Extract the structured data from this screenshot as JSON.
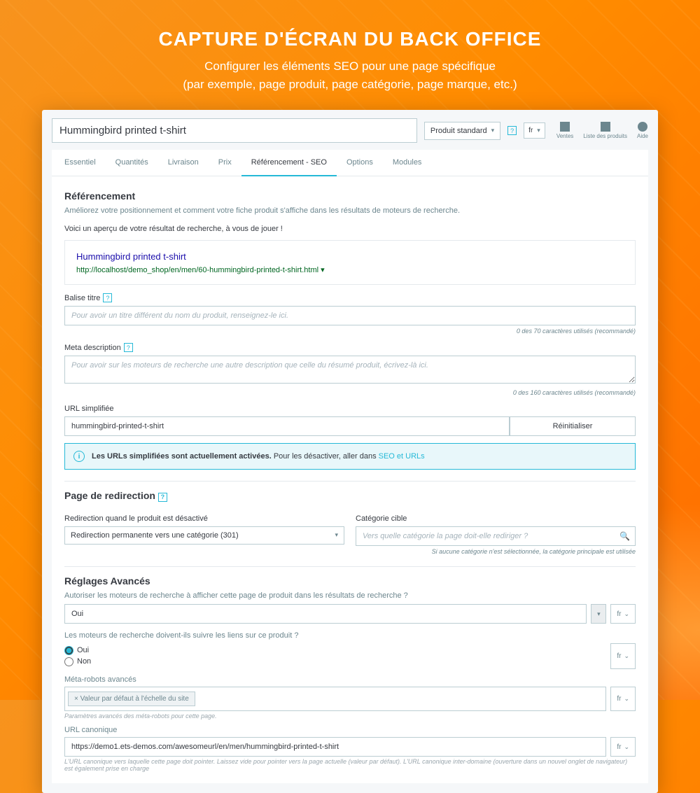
{
  "hero": {
    "title": "CAPTURE D'ÉCRAN DU BACK OFFICE",
    "line1": "Configurer les éléments SEO pour une page spécifique",
    "line2": "(par exemple, page produit, page catégorie, page marque, etc.)"
  },
  "topbar": {
    "title": "Hummingbird printed t-shirt",
    "productType": "Produit standard",
    "lang": "fr",
    "icons": {
      "sales": "Ventes",
      "list": "Liste des produits",
      "help": "Aide"
    }
  },
  "tabs": [
    "Essentiel",
    "Quantités",
    "Livraison",
    "Prix",
    "Référencement - SEO",
    "Options",
    "Modules"
  ],
  "tabs_active": 4,
  "seo": {
    "heading": "Référencement",
    "intro": "Améliorez votre positionnement et comment votre fiche produit s'affiche dans les résultats de moteurs de recherche.",
    "previewLabel": "Voici un aperçu de votre résultat de recherche, à vous de jouer !",
    "preview": {
      "title": "Hummingbird printed t-shirt",
      "url": "http://localhost/demo_shop/en/men/60-hummingbird-printed-t-shirt.html"
    },
    "titleTag": {
      "label": "Balise titre",
      "placeholder": "Pour avoir un titre différent du nom du produit, renseignez-le ici.",
      "hint": "0 des 70 caractères utilisés (recommandé)"
    },
    "metaDesc": {
      "label": "Meta description",
      "placeholder": "Pour avoir sur les moteurs de recherche une autre description que celle du résumé produit, écrivez-là ici.",
      "hint": "0 des 160 caractères utilisés (recommandé)"
    },
    "friendly": {
      "label": "URL simplifiée",
      "value": "hummingbird-printed-t-shirt",
      "reset": "Réinitialiser"
    },
    "alert": {
      "bold": "Les URLs simplifiées sont actuellement activées.",
      "text": " Pour les désactiver, aller dans ",
      "link": "SEO et URLs"
    }
  },
  "redir": {
    "heading": "Page de redirection",
    "whenLabel": "Redirection quand le produit est désactivé",
    "whenValue": "Redirection permanente vers une catégorie (301)",
    "targetLabel": "Catégorie cible",
    "targetPlaceholder": "Vers quelle catégorie la page doit-elle rediriger ?",
    "note": "Si aucune catégorie n'est sélectionnée, la catégorie principale est utilisée"
  },
  "adv": {
    "heading": "Réglages Avancés",
    "allowLabel": "Autoriser les moteurs de recherche à afficher cette page de produit dans les résultats de recherche ?",
    "allowValue": "Oui",
    "followLabel": "Les moteurs de recherche doivent-ils suivre les liens sur ce produit ?",
    "yes": "Oui",
    "no": "Non",
    "robotsLabel": "Méta-robots avancés",
    "robotsChip": "× Valeur par défaut à l'échelle du site",
    "robotsHint": "Paramètres avancés des méta-robots pour cette page.",
    "canonLabel": "URL canonique",
    "canonValue": "https://demo1.ets-demos.com/awesomeurl/en/men/hummingbird-printed-t-shirt",
    "canonHint": "L'URL canonique vers laquelle cette page doit pointer. Laissez vide pour pointer vers la page actuelle (valeur par défaut). L'URL canonique inter-domaine (ouverture dans un nouvel onglet de navigateur) est également prise en charge",
    "lang": "fr"
  }
}
